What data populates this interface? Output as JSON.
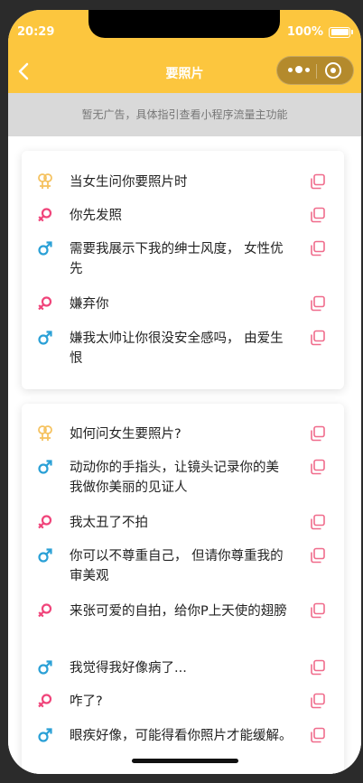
{
  "status_bar": {
    "time": "20:29",
    "battery": "100%"
  },
  "navbar": {
    "title": "要照片"
  },
  "ad_banner": {
    "text": "暂无广告，具体指引查看小程序流量主功能"
  },
  "colors": {
    "brand": "#fcc63e",
    "female": "#f0447a",
    "male": "#2aa0d6",
    "pair": "#f5c260",
    "copy": "#f06c8c"
  },
  "cards": [
    {
      "rows": [
        {
          "icon": "gender-pair-icon",
          "text": "当女生问你要照片时"
        },
        {
          "icon": "female-icon",
          "text": "你先发照"
        },
        {
          "icon": "male-icon",
          "text": "需要我展示下我的绅士风度， 女性优先"
        },
        {
          "icon": "female-icon",
          "text": "嫌弃你"
        },
        {
          "icon": "male-icon",
          "text": "嫌我太帅让你很没安全感吗， 由爱生恨"
        }
      ]
    },
    {
      "rows": [
        {
          "icon": "gender-pair-icon",
          "text": "如何问女生要照片?"
        },
        {
          "icon": "male-icon",
          "text": "动动你的手指头，让镜头记录你的美 我做你美丽的见证人"
        },
        {
          "icon": "female-icon",
          "text": "我太丑了不拍"
        },
        {
          "icon": "male-icon",
          "text": "你可以不尊重自己， 但请你尊重我的审美观"
        },
        {
          "icon": "female-icon",
          "text": "来张可爱的自拍，给你P上天使的翅膀"
        },
        {
          "icon": "male-icon",
          "text": "我觉得我好像病了..."
        },
        {
          "icon": "female-icon",
          "text": "咋了?"
        },
        {
          "icon": "male-icon",
          "text": "眼疾好像，可能得看你照片才能缓解。"
        }
      ]
    }
  ]
}
